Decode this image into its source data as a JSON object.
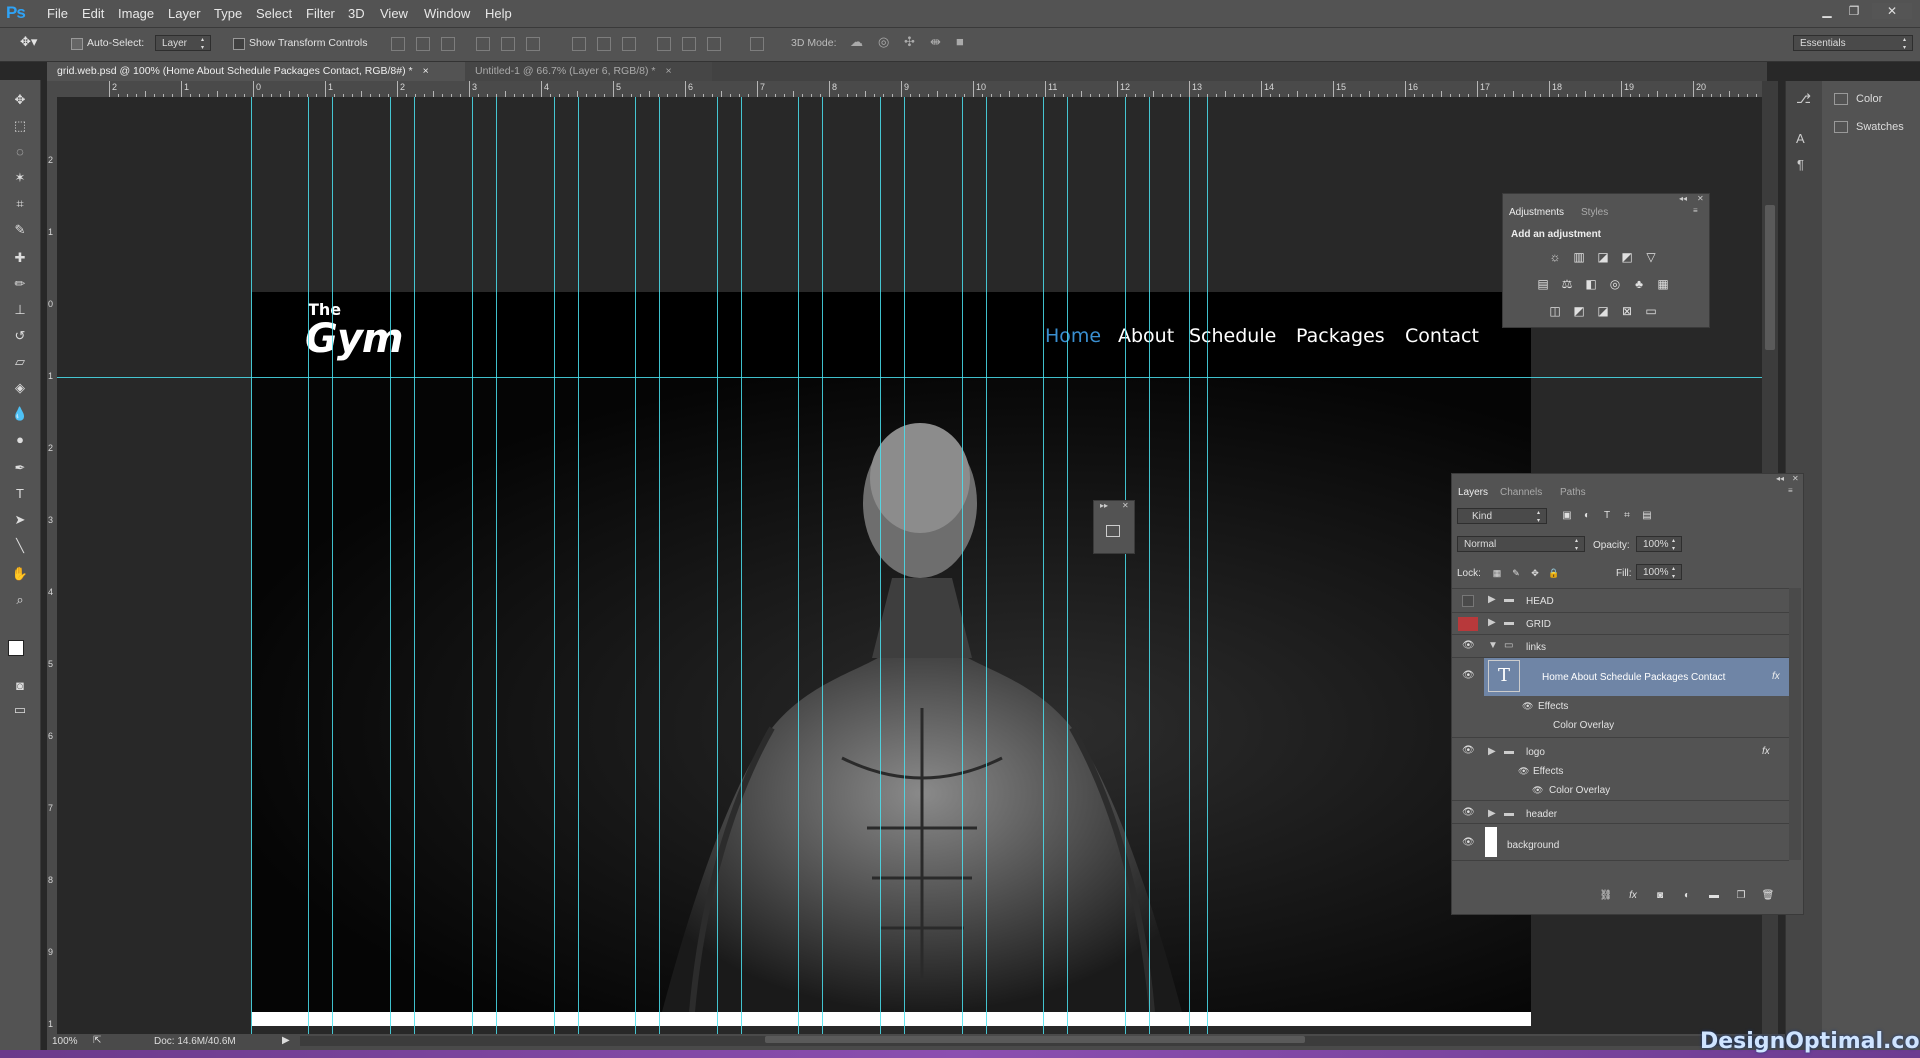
{
  "app": {
    "logo": "Ps"
  },
  "menu": [
    "File",
    "Edit",
    "Image",
    "Layer",
    "Type",
    "Select",
    "Filter",
    "3D",
    "View",
    "Window",
    "Help"
  ],
  "options": {
    "auto_select_label": "Auto-Select:",
    "auto_select_value": "Layer",
    "show_transform_label": "Show Transform Controls",
    "mode_3d_label": "3D Mode:",
    "workspace": "Essentials"
  },
  "tabs": [
    {
      "label": "grid.web.psd @ 100% (Home About Schedule Packages Contact, RGB/8#) *",
      "close": "×"
    },
    {
      "label": "Untitled-1 @ 66.7% (Layer 6, RGB/8) *",
      "close": "×"
    }
  ],
  "ruler": {
    "h": [
      "2",
      "1",
      "0",
      "1",
      "2",
      "3",
      "4",
      "5",
      "6",
      "7",
      "8",
      "9",
      "10",
      "11",
      "12",
      "13",
      "14",
      "15",
      "16",
      "17",
      "18",
      "19",
      "20"
    ],
    "v": [
      "2",
      "1",
      "0",
      "1",
      "2",
      "3",
      "4",
      "5",
      "6",
      "7",
      "8",
      "9",
      "1"
    ]
  },
  "site": {
    "logo_the": "The",
    "logo_gym": "Gym",
    "nav": [
      "Home",
      "About",
      "Schedule",
      "Packages",
      "Contact"
    ],
    "active_color": "#3a8fd0"
  },
  "dock": {
    "color": "Color",
    "swatches": "Swatches"
  },
  "adjustments": {
    "tab_adjustments": "Adjustments",
    "tab_styles": "Styles",
    "heading": "Add an adjustment"
  },
  "layers_panel": {
    "tabs": [
      "Layers",
      "Channels",
      "Paths"
    ],
    "filter_kind": "Kind",
    "blend_mode": "Normal",
    "opacity_label": "Opacity:",
    "opacity_value": "100%",
    "lock_label": "Lock:",
    "fill_label": "Fill:",
    "fill_value": "100%",
    "rows": {
      "head": "HEAD",
      "grid": "GRID",
      "links": "links",
      "text_layer": "Home About Schedule Packages Contact",
      "effects1": "Effects",
      "overlay1": "Color Overlay",
      "logo": "logo",
      "effects2": "Effects",
      "overlay2": "Color Overlay",
      "header": "header",
      "background": "background"
    },
    "fx": "fx"
  },
  "status": {
    "zoom": "100%",
    "doc": "Doc: 14.6M/40.6M"
  },
  "watermark": "DesignOptimal.com"
}
